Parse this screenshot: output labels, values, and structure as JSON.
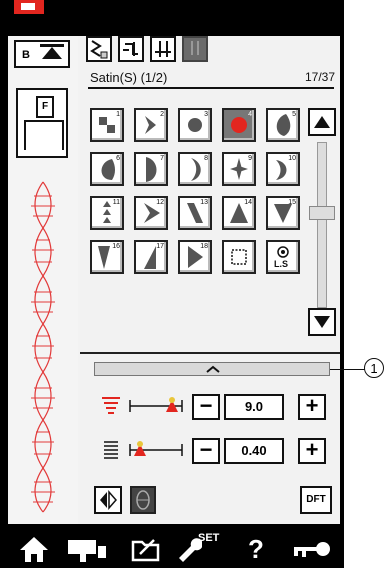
{
  "header": {
    "needle_label": "B"
  },
  "presser_foot": {
    "label": "F"
  },
  "tabs": [
    {
      "icon": "satin-stitches-icon"
    },
    {
      "icon": "foot-swap-icon"
    },
    {
      "icon": "needle-position-icon"
    },
    {
      "icon": "twin-needle-icon"
    }
  ],
  "pattern_group": {
    "title": "Satin(S) (1/2)",
    "count": "17/37"
  },
  "patterns": [
    "1",
    "2",
    "3",
    "4",
    "5",
    "6",
    "7",
    "8",
    "9",
    "10",
    "11",
    "12",
    "13",
    "14",
    "15",
    "16",
    "17",
    "18",
    "",
    ""
  ],
  "selected_pattern": 4,
  "extra_cells": {
    "last_label": "L.S"
  },
  "callout": "1",
  "settings": {
    "width_value": "9.0",
    "length_value": "0.40",
    "minus": "−",
    "plus": "+"
  },
  "bottom_buttons": {
    "dft_label": "DFT",
    "set_label": "SET",
    "help_label": "?"
  },
  "colors": {
    "accent": "#e2261f",
    "stitch": "#e23a3a"
  }
}
